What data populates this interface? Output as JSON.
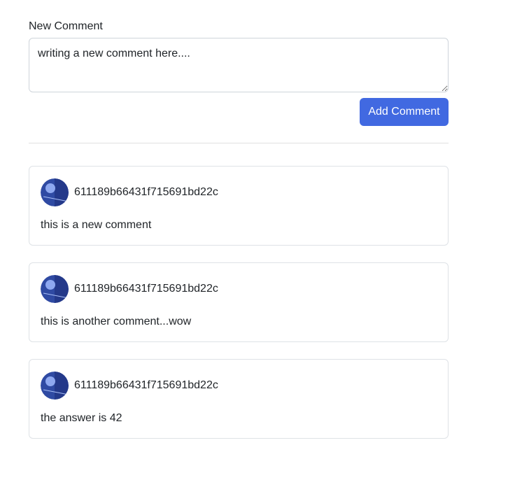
{
  "form": {
    "label": "New Comment",
    "textarea_value": "writing a new comment here....",
    "submit_label": "Add Comment"
  },
  "comments": [
    {
      "author": "611189b66431f715691bd22c",
      "text": "this is a new comment"
    },
    {
      "author": "611189b66431f715691bd22c",
      "text": "this is another comment...wow"
    },
    {
      "author": "611189b66431f715691bd22c",
      "text": "the answer is 42"
    }
  ],
  "colors": {
    "accent": "#4169e1",
    "avatar_bg": "#2f4aa3",
    "avatar_fg": "#8ea8f0"
  },
  "icons": {
    "avatar": "user-avatar-icon"
  }
}
